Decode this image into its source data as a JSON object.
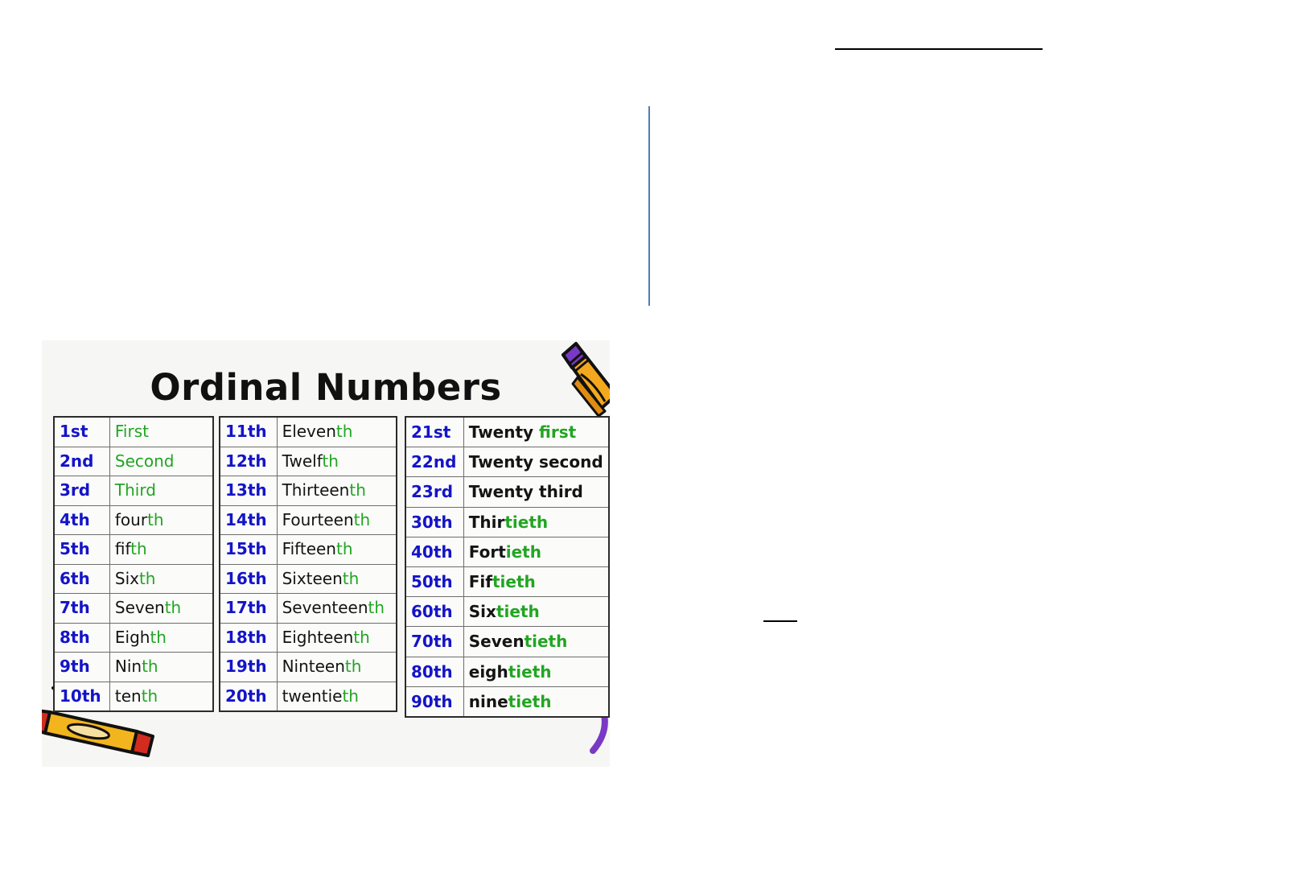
{
  "page": {
    "background_color": "#ffffff",
    "marks": {
      "top_rule_color": "#000000",
      "blue_rule_color": "#4a7ebb",
      "small_rule_color": "#000000"
    }
  },
  "poster": {
    "title": "Ordinal Numbers",
    "background_color": "#f6f6f4",
    "number_color": "#1414c8",
    "word_color": "#141414",
    "suffix_color": "#22a522",
    "decorations": [
      {
        "name": "pencil-icon",
        "colors": [
          "#f5a623",
          "#e8941a",
          "#7a39c4",
          "#111111"
        ]
      },
      {
        "name": "crayons-icon",
        "colors": [
          "#f5c33b",
          "#e8941a",
          "#d42b1f",
          "#111111"
        ]
      },
      {
        "name": "purple-swirl-icon",
        "colors": [
          "#7a39c4"
        ]
      }
    ]
  },
  "tables": [
    {
      "id": "column-1",
      "rows": [
        {
          "ordinal": "1st",
          "stem": "",
          "suffix": "First",
          "all_green": true
        },
        {
          "ordinal": "2nd",
          "stem": "",
          "suffix": "Second",
          "all_green": true
        },
        {
          "ordinal": "3rd",
          "stem": "",
          "suffix": "Third",
          "all_green": true
        },
        {
          "ordinal": "4th",
          "stem": "four",
          "suffix": "th",
          "all_green": false
        },
        {
          "ordinal": "5th",
          "stem": "fif",
          "suffix": "th",
          "all_green": false
        },
        {
          "ordinal": "6th",
          "stem": "Six",
          "suffix": "th",
          "all_green": false
        },
        {
          "ordinal": "7th",
          "stem": "Seven",
          "suffix": "th",
          "all_green": false
        },
        {
          "ordinal": "8th",
          "stem": "Eigh",
          "suffix": "th",
          "all_green": false
        },
        {
          "ordinal": "9th",
          "stem": "Nin",
          "suffix": "th",
          "all_green": false
        },
        {
          "ordinal": "10th",
          "stem": "ten",
          "suffix": "th",
          "all_green": false
        }
      ]
    },
    {
      "id": "column-2",
      "rows": [
        {
          "ordinal": "11th",
          "stem": "Eleven",
          "suffix": "th",
          "all_green": false
        },
        {
          "ordinal": "12th",
          "stem": "Twelf",
          "suffix": "th",
          "all_green": false
        },
        {
          "ordinal": "13th",
          "stem": "Thirteen",
          "suffix": "th",
          "all_green": false
        },
        {
          "ordinal": "14th",
          "stem": "Fourteen",
          "suffix": "th",
          "all_green": false
        },
        {
          "ordinal": "15th",
          "stem": "Fifteen",
          "suffix": "th",
          "all_green": false
        },
        {
          "ordinal": "16th",
          "stem": "Sixteen",
          "suffix": "th",
          "all_green": false
        },
        {
          "ordinal": "17th",
          "stem": "Seventeen",
          "suffix": "th",
          "all_green": false
        },
        {
          "ordinal": "18th",
          "stem": "Eighteen",
          "suffix": "th",
          "all_green": false
        },
        {
          "ordinal": "19th",
          "stem": "Ninteen",
          "suffix": "th",
          "all_green": false
        },
        {
          "ordinal": "20th",
          "stem": "twentie",
          "suffix": "th",
          "all_green": false
        }
      ]
    },
    {
      "id": "column-3",
      "rows": [
        {
          "ordinal": "21st",
          "stem": "Twenty ",
          "suffix": "first",
          "all_green": false
        },
        {
          "ordinal": "22nd",
          "stem": "Twenty second",
          "suffix": "",
          "all_green": false
        },
        {
          "ordinal": "23rd",
          "stem": "Twenty third",
          "suffix": "",
          "all_green": false
        },
        {
          "ordinal": "30th",
          "stem": "Thir",
          "suffix": "tieth",
          "all_green": false
        },
        {
          "ordinal": "40th",
          "stem": "Fort",
          "suffix": "ieth",
          "all_green": false
        },
        {
          "ordinal": "50th",
          "stem": "Fif",
          "suffix": "tieth",
          "all_green": false
        },
        {
          "ordinal": "60th",
          "stem": "Six",
          "suffix": "tieth",
          "all_green": false
        },
        {
          "ordinal": "70th",
          "stem": "Seven",
          "suffix": "tieth",
          "all_green": false
        },
        {
          "ordinal": "80th",
          "stem": "eigh",
          "suffix": "tieth",
          "all_green": false
        },
        {
          "ordinal": "90th",
          "stem": "nine",
          "suffix": "tieth",
          "all_green": false
        }
      ]
    }
  ]
}
